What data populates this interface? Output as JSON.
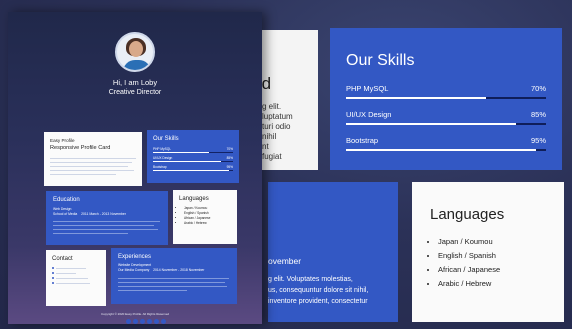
{
  "profile": {
    "greeting": "Hi, I am Loby",
    "role": "Creative Director"
  },
  "easy_card": {
    "label": "Easy Profile",
    "title": "Responsive Profile Card"
  },
  "skills": {
    "title": "Our Skills",
    "items": [
      {
        "label": "PHP MySQL",
        "percent": "70%",
        "value": 70
      },
      {
        "label": "UI/UX Design",
        "percent": "85%",
        "value": 85
      },
      {
        "label": "Bootstrap",
        "percent": "95%",
        "value": 95
      }
    ]
  },
  "education": {
    "title": "Education",
    "subtitle": "Web Design",
    "school": "School of Media",
    "dates": "2011 March - 2013 November",
    "big_month": "ovember",
    "big_text": "g elit. Voluptates molestias,\nus, consequuntur dolore sit nihil,\ninventore provident, consectetur"
  },
  "languages": {
    "title": "Languages",
    "items": [
      "Japan / Koumou",
      "English / Spanish",
      "African / Japanese",
      "Arabic / Hebrew"
    ]
  },
  "contact": {
    "title": "Contact"
  },
  "experiences": {
    "title": "Experiences",
    "subtitle": "Website Development",
    "company": "Our Media Company",
    "dates": "2014 November - 2018 November"
  },
  "bg_card": {
    "big_title": "rd",
    "text": "g elit.\nluptatum\nturi odio\nnihil\nnt\nfugiat"
  },
  "footer": {
    "copyright": "Copyright © 2020 Easy Profile. All Rights Reserved"
  }
}
